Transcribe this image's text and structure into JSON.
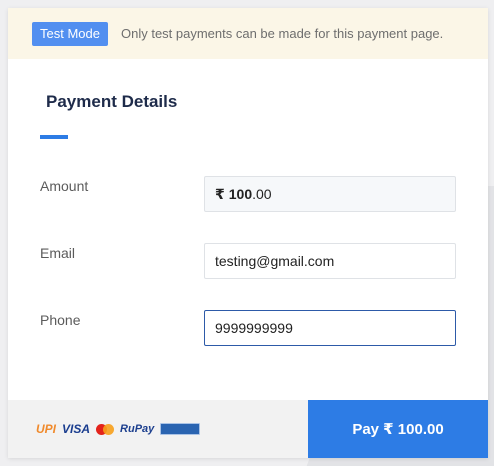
{
  "banner": {
    "badge": "Test Mode",
    "message": "Only test payments can be made for this payment page."
  },
  "section": {
    "title": "Payment Details"
  },
  "form": {
    "amount": {
      "label": "Amount",
      "currency_symbol": "₹",
      "value_whole": "100",
      "value_decimal": ".00"
    },
    "email": {
      "label": "Email",
      "value": "testing@gmail.com"
    },
    "phone": {
      "label": "Phone",
      "value": "9999999999"
    }
  },
  "footer": {
    "payment_logos": [
      "UPI",
      "VISA",
      "mastercard",
      "RuPay",
      "netbanking"
    ],
    "pay_button_label": "Pay  ₹ 100.00"
  },
  "colors": {
    "accent": "#2d7ce5",
    "badge": "#528ff0",
    "banner_bg": "#fbf6e7"
  }
}
